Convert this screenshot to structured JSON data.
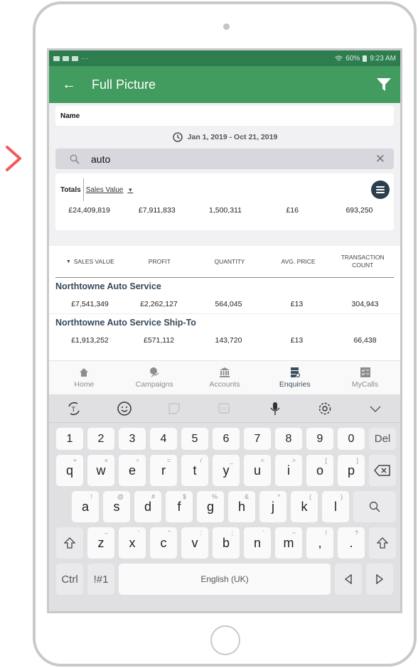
{
  "status_bar": {
    "battery": "60%",
    "time": "9:23 AM"
  },
  "app_bar": {
    "title": "Full Picture",
    "back_icon": "arrow-left-icon",
    "filter_icon": "filter-icon"
  },
  "name_field": {
    "label": "Name"
  },
  "date_range": {
    "text": "Jan 1, 2019 - Oct 21, 2019",
    "icon": "history-icon"
  },
  "search": {
    "value": "auto",
    "placeholder": ""
  },
  "totals": {
    "label": "Totals",
    "metric": "Sales Value",
    "values": [
      "£24,409,819",
      "£7,911,833",
      "1,500,311",
      "£16",
      "693,250"
    ]
  },
  "table": {
    "columns": [
      "SALES VALUE",
      "PROFIT",
      "QUANTITY",
      "AVG. PRICE",
      "TRANSACTION COUNT"
    ],
    "sort_column": "SALES VALUE",
    "rows": [
      {
        "name": "Northtowne Auto Service",
        "values": [
          "£7,541,349",
          "£2,262,127",
          "564,045",
          "£13",
          "304,943"
        ]
      },
      {
        "name": "Northtowne Auto Service Ship-To",
        "values": [
          "£1,913,252",
          "£571,112",
          "143,720",
          "£13",
          "66,438"
        ]
      }
    ]
  },
  "bottom_nav": {
    "items": [
      {
        "label": "Home",
        "icon": "home-icon"
      },
      {
        "label": "Campaigns",
        "icon": "campaigns-icon"
      },
      {
        "label": "Accounts",
        "icon": "bank-icon"
      },
      {
        "label": "Enquiries",
        "icon": "enquiries-icon"
      },
      {
        "label": "MyCalls",
        "icon": "checklist-icon"
      }
    ],
    "active": "Enquiries"
  },
  "keyboard": {
    "number_row": [
      "1",
      "2",
      "3",
      "4",
      "5",
      "6",
      "7",
      "8",
      "9",
      "0",
      "Del"
    ],
    "row1": [
      [
        "q",
        "+"
      ],
      [
        "w",
        "×"
      ],
      [
        "e",
        "÷"
      ],
      [
        "r",
        "="
      ],
      [
        "t",
        "/"
      ],
      [
        "y",
        "_"
      ],
      [
        "u",
        "<"
      ],
      [
        "i",
        ">"
      ],
      [
        "o",
        "["
      ],
      [
        "p",
        "]"
      ]
    ],
    "row2": [
      [
        "a",
        "!"
      ],
      [
        "s",
        "@"
      ],
      [
        "d",
        "#"
      ],
      [
        "f",
        "$"
      ],
      [
        "g",
        "%"
      ],
      [
        "h",
        "&"
      ],
      [
        "j",
        "*"
      ],
      [
        "k",
        "("
      ],
      [
        "l",
        ")"
      ]
    ],
    "row3": [
      [
        "z",
        "–"
      ],
      [
        "x",
        "'"
      ],
      [
        "c",
        "\""
      ],
      [
        "v",
        ":"
      ],
      [
        "b",
        ";"
      ],
      [
        "n",
        "`"
      ],
      [
        "m",
        "~"
      ],
      [
        ",",
        "!"
      ],
      [
        ".",
        "?"
      ]
    ],
    "ctrl": "Ctrl",
    "symbols": "!#1",
    "space": "English (UK)"
  }
}
